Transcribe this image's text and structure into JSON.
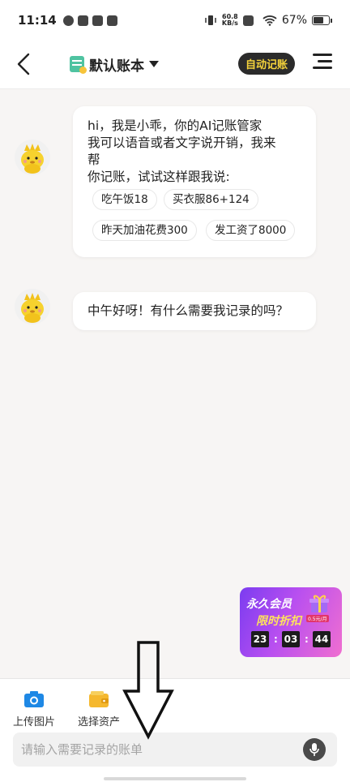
{
  "status_bar": {
    "time": "11:14",
    "net_speed_value": "60.8",
    "net_speed_unit": "KB/s",
    "battery": "67%"
  },
  "header": {
    "book_name": "默认账本",
    "auto_button": "自动记账"
  },
  "messages": [
    {
      "lines": [
        "hi，我是小乖，你的AI记账管家",
        "我可以语音或者文字说开销，我来",
        "帮",
        "你记账，试试这样跟我说:"
      ],
      "suggestions": [
        "吃午饭18",
        "买衣服86+124",
        "昨天加油花费300",
        "发工资了8000"
      ]
    },
    {
      "lines": [
        "中午好呀！有什么需要我记录的吗？"
      ]
    }
  ],
  "promo": {
    "line1": "永久会员",
    "line2": "限时折扣",
    "price_tag": "0.5元/月",
    "timer": [
      "23",
      "03",
      "44"
    ],
    "separator": ":"
  },
  "bottom": {
    "tools": [
      "上传图片",
      "选择资产"
    ],
    "input_placeholder": "请输入需要记录的账单"
  },
  "colors": {
    "accent_yellow": "#f5d33b",
    "dark_button": "#2b2b2b",
    "page_bg": "#f7f5f4"
  }
}
